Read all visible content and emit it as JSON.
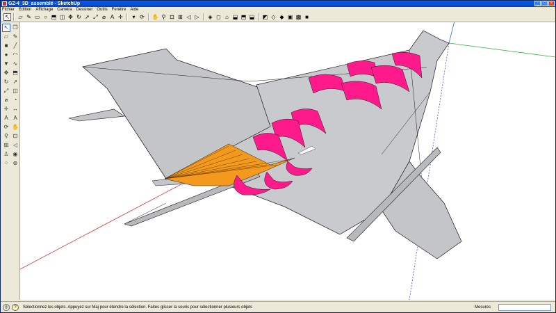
{
  "window": {
    "title": "GZ-4_3D_assemblé - SketchUp",
    "min_glyph": "_",
    "max_glyph": "□",
    "close_glyph": "×"
  },
  "menubar": {
    "items": [
      {
        "label": "Fichier"
      },
      {
        "label": "Edition"
      },
      {
        "label": "Affichage"
      },
      {
        "label": "Caméra"
      },
      {
        "label": "Dessiner"
      },
      {
        "label": "Outils"
      },
      {
        "label": "Fenêtre"
      },
      {
        "label": "Aide"
      }
    ]
  },
  "toolbar": {
    "buttons": [
      {
        "name": "select-icon",
        "glyph": "↖",
        "active": true
      },
      {
        "name": "eraser-icon",
        "glyph": "▱"
      },
      {
        "name": "pencil-icon",
        "glyph": "✎"
      },
      {
        "name": "rectangle-icon",
        "glyph": "▭"
      },
      {
        "name": "circle-icon",
        "glyph": "○"
      },
      {
        "name": "pushpull-icon",
        "glyph": "⬒"
      },
      {
        "name": "offset-icon",
        "glyph": "◫"
      },
      {
        "name": "move-icon",
        "glyph": "✥"
      },
      {
        "name": "rotate-icon",
        "glyph": "↻"
      },
      {
        "name": "followme-icon",
        "glyph": "➚"
      },
      {
        "name": "scale-icon",
        "glyph": "⤢"
      },
      {
        "name": "tape-icon",
        "glyph": "⌀"
      },
      {
        "name": "text-icon",
        "glyph": "A"
      },
      {
        "name": "axes-icon",
        "glyph": "✛"
      },
      {
        "name": "paint-icon",
        "glyph": "▾"
      },
      {
        "name": "orbit-icon",
        "glyph": "⟳"
      },
      {
        "name": "pan-icon",
        "glyph": "✋"
      },
      {
        "name": "zoom-icon",
        "glyph": "⚲"
      },
      {
        "name": "zoom-window-icon",
        "glyph": "⊡"
      },
      {
        "name": "zoom-extents-icon",
        "glyph": "⊞"
      },
      {
        "name": "previous-view-icon",
        "glyph": "◁"
      },
      {
        "name": "next-view-icon",
        "glyph": "▷"
      },
      {
        "name": "iso-view-icon",
        "glyph": "◈"
      },
      {
        "name": "top-view-icon",
        "glyph": "◻"
      },
      {
        "name": "front-view-icon",
        "glyph": "⌂"
      },
      {
        "name": "right-view-icon",
        "glyph": "⬓"
      },
      {
        "name": "back-view-icon",
        "glyph": "⬒"
      },
      {
        "name": "left-view-icon",
        "glyph": "⬓"
      },
      {
        "name": "xray-icon",
        "glyph": "◩"
      },
      {
        "name": "wireframe-icon",
        "glyph": "◇"
      },
      {
        "name": "hidden-line-icon",
        "glyph": "◆"
      },
      {
        "name": "shaded-icon",
        "glyph": "▣"
      },
      {
        "name": "textured-icon",
        "glyph": "▩"
      },
      {
        "name": "monochrome-icon",
        "glyph": "■"
      }
    ]
  },
  "lefttools": {
    "buttons": [
      {
        "name": "select-tool-icon",
        "glyph": "↖",
        "active": true
      },
      {
        "name": "make-component-icon",
        "glyph": "❐"
      },
      {
        "name": "eraser-tool-icon",
        "glyph": "▱"
      },
      {
        "name": "pencil-tool-icon",
        "glyph": "✎"
      },
      {
        "name": "rectangle-tool-icon",
        "glyph": "■"
      },
      {
        "name": "line-tool-icon",
        "glyph": "╱"
      },
      {
        "name": "circle-tool-icon",
        "glyph": "●"
      },
      {
        "name": "arc-tool-icon",
        "glyph": "◠"
      },
      {
        "name": "polygon-tool-icon",
        "glyph": "▼"
      },
      {
        "name": "freehand-tool-icon",
        "glyph": "∿"
      },
      {
        "name": "move-tool-icon",
        "glyph": "✥"
      },
      {
        "name": "pushpull-tool-icon",
        "glyph": "⬒"
      },
      {
        "name": "rotate-tool-icon",
        "glyph": "↻"
      },
      {
        "name": "followme-tool-icon",
        "glyph": "➚"
      },
      {
        "name": "scale-tool-icon",
        "glyph": "⤢"
      },
      {
        "name": "offset-tool-icon",
        "glyph": "◫"
      },
      {
        "name": "tape-tool-icon",
        "glyph": "⌀"
      },
      {
        "name": "protractor-tool-icon",
        "glyph": "◔"
      },
      {
        "name": "axes-tool-icon",
        "glyph": "✛"
      },
      {
        "name": "dimension-tool-icon",
        "glyph": "↔"
      },
      {
        "name": "text-tool-icon",
        "glyph": "A"
      },
      {
        "name": "3dtext-tool-icon",
        "glyph": "A"
      },
      {
        "name": "orbit-tool-icon",
        "glyph": "⟳"
      },
      {
        "name": "pan-tool-icon",
        "glyph": "✋"
      },
      {
        "name": "zoom-tool-icon",
        "glyph": "⚲"
      },
      {
        "name": "zoom-window-tool-icon",
        "glyph": "⊡"
      },
      {
        "name": "zoom-extents-tool-icon",
        "glyph": "⊞"
      },
      {
        "name": "previous-tool-icon",
        "glyph": "◁"
      },
      {
        "name": "position-camera-icon",
        "glyph": "♙"
      },
      {
        "name": "look-around-icon",
        "glyph": "◉"
      },
      {
        "name": "walk-tool-icon",
        "glyph": "⁘"
      },
      {
        "name": "section-plane-icon",
        "glyph": "⊛"
      }
    ]
  },
  "statusbar": {
    "geo_glyph": "◎",
    "help_glyph": "?",
    "message": "Sélectionnez les objets. Appuyez sur Maj pour étendre la sélection. Faites glisser la souris pour sélectionner plusieurs objets",
    "measure_label": "Mesures",
    "measure_value": ""
  },
  "colors": {
    "model_surface": "#c4c5c9",
    "model_edge": "#1a1a1a",
    "intake_ring": "#ff1a8c",
    "orange_part": "#f39a1e",
    "axis_red": "#d23a3a",
    "axis_green": "#3ab54a",
    "axis_blue": "#3a5ad2"
  }
}
